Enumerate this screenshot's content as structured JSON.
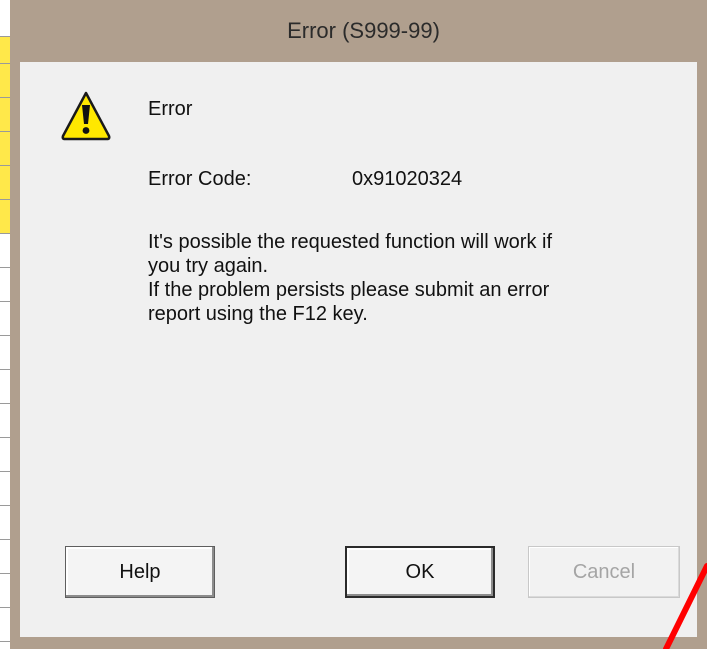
{
  "window": {
    "title": "Error (S999-99)"
  },
  "dialog": {
    "icon": "warning-icon",
    "heading": "Error",
    "error_code_label": "Error Code:",
    "error_code_value": "0x91020324",
    "message_lines": [
      "It's possible the requested function will work if",
      "you try again.",
      "If the problem persists please submit an error",
      "report using the F12 key."
    ]
  },
  "buttons": {
    "help": "Help",
    "ok": "OK",
    "cancel": "Cancel"
  },
  "colors": {
    "frame": "#b09f8e",
    "client": "#f0f0f0",
    "warning_fill": "#ffe800",
    "annotation": "#ff0000"
  }
}
